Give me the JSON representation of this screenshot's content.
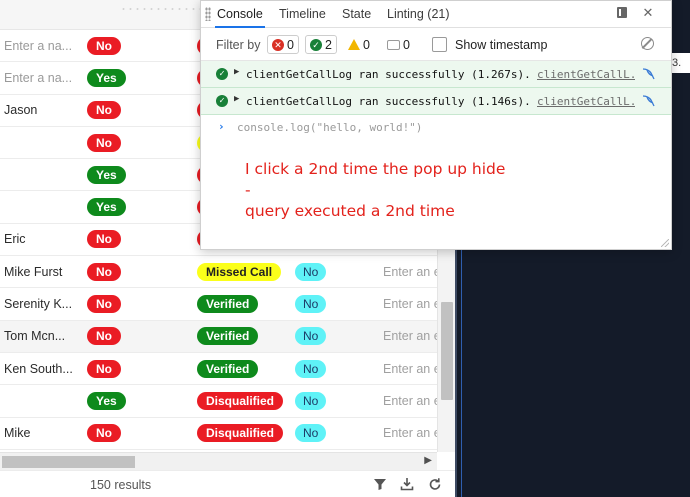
{
  "table": {
    "rows": [
      {
        "name": "Enter a na...",
        "name_placeholder": true,
        "yn": "No",
        "yn_color": "red",
        "status": "",
        "status_color": "red",
        "flag": "",
        "extra": ""
      },
      {
        "name": "Enter a na...",
        "name_placeholder": true,
        "yn": "Yes",
        "yn_color": "green",
        "status": "",
        "status_color": "red",
        "flag": "",
        "extra": ""
      },
      {
        "name": "Jason",
        "name_placeholder": false,
        "yn": "No",
        "yn_color": "red",
        "status": "",
        "status_color": "red",
        "flag": "",
        "extra": ""
      },
      {
        "name": "",
        "name_placeholder": false,
        "yn": "No",
        "yn_color": "red",
        "status": "",
        "status_color": "yellow",
        "flag": "",
        "extra": ""
      },
      {
        "name": "",
        "name_placeholder": false,
        "yn": "Yes",
        "yn_color": "green",
        "status": "",
        "status_color": "red",
        "flag": "",
        "extra": ""
      },
      {
        "name": "",
        "name_placeholder": false,
        "yn": "Yes",
        "yn_color": "green",
        "status": "",
        "status_color": "red",
        "flag": "",
        "extra": ""
      },
      {
        "name": "Eric",
        "name_placeholder": false,
        "yn": "No",
        "yn_color": "red",
        "status": "",
        "status_color": "red",
        "flag": "",
        "extra": ""
      },
      {
        "name": "Mike Furst",
        "name_placeholder": false,
        "yn": "No",
        "yn_color": "red",
        "status": "Missed Call",
        "status_color": "yellow",
        "flag": "No",
        "extra": "Enter an e"
      },
      {
        "name": "Serenity K...",
        "name_placeholder": false,
        "yn": "No",
        "yn_color": "red",
        "status": "Verified",
        "status_color": "green",
        "flag": "No",
        "extra": "Enter an e"
      },
      {
        "name": "Tom Mcn...",
        "name_placeholder": false,
        "yn": "No",
        "yn_color": "red",
        "status": "Verified",
        "status_color": "green",
        "flag": "No",
        "extra": "Enter an e"
      },
      {
        "name": "Ken South...",
        "name_placeholder": false,
        "yn": "No",
        "yn_color": "red",
        "status": "Verified",
        "status_color": "green",
        "flag": "No",
        "extra": "Enter an e"
      },
      {
        "name": "",
        "name_placeholder": false,
        "yn": "Yes",
        "yn_color": "green",
        "status": "Disqualified",
        "status_color": "red",
        "flag": "No",
        "extra": "Enter an e"
      },
      {
        "name": "Mike",
        "name_placeholder": false,
        "yn": "No",
        "yn_color": "red",
        "status": "Disqualified",
        "status_color": "red",
        "flag": "No",
        "extra": "Enter an e"
      }
    ],
    "result_count": "150 results",
    "footer_icons": [
      "filter-icon",
      "download-icon",
      "refresh-icon"
    ]
  },
  "devtools": {
    "tabs": [
      "Console",
      "Timeline",
      "State",
      "Linting (21)"
    ],
    "active_tab": "Console",
    "header_icons": [
      "docs-icon",
      "close-icon"
    ],
    "filter": {
      "label": "Filter by",
      "error_count": "0",
      "success_count": "2",
      "warning_count": "0",
      "info_count": "0",
      "show_timestamp_label": "Show timestamp",
      "show_timestamp_checked": false
    },
    "logs": [
      {
        "message": "clientGetCallLog ran successfully (1.267s).",
        "source": "clientGetCallL..."
      },
      {
        "message": "clientGetCallLog ran successfully (1.146s).",
        "source": "clientGetCallL..."
      }
    ],
    "console_input": "console.log(\"hello, world!\")",
    "annotation_line1": "I click a 2nd time the pop up hide -",
    "annotation_line2": "query executed a 2nd time"
  },
  "right_panel": {
    "edge_fragment": "3."
  },
  "colors": {
    "pill_red": "#ea1c24",
    "pill_green": "#0e8a1c",
    "pill_yellow": "#fbff1a",
    "pill_cyan": "#5ff2f7",
    "dark_panel": "#141b29",
    "annotation": "#e3221c",
    "active_tab": "#1a73e8",
    "success_row": "#edf8ef"
  }
}
